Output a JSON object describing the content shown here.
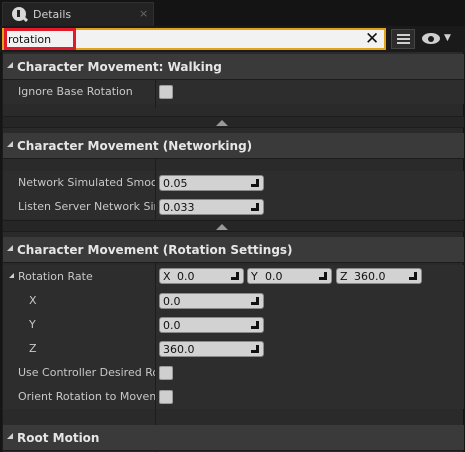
{
  "tab": {
    "title": "Details",
    "close": "×"
  },
  "search": {
    "value": "rotation",
    "clear": "✕"
  },
  "categories": [
    {
      "title": "Character Movement: Walking"
    },
    {
      "title": "Character Movement (Networking)"
    },
    {
      "title": "Character Movement (Rotation Settings)"
    },
    {
      "title": "Root Motion"
    }
  ],
  "walking": {
    "ignore_base_rotation": "Ignore Base Rotation"
  },
  "networking": {
    "smooth_label": "Network Simulated Smooth",
    "smooth_value": "0.05",
    "listen_label": "Listen Server Network Sim",
    "listen_value": "0.033"
  },
  "rotation": {
    "rate_label": "Rotation Rate",
    "x_axis": "X",
    "x_value": "0.0",
    "y_axis": "Y",
    "y_value": "0.0",
    "z_axis": "Z",
    "z_value": "360.0",
    "x_label": "X",
    "y_label": "Y",
    "z_label": "Z",
    "x_field": "0.0",
    "y_field": "0.0",
    "z_field": "360.0",
    "controller_label": "Use Controller Desired Rota",
    "orient_label": "Orient Rotation to Moveme"
  }
}
